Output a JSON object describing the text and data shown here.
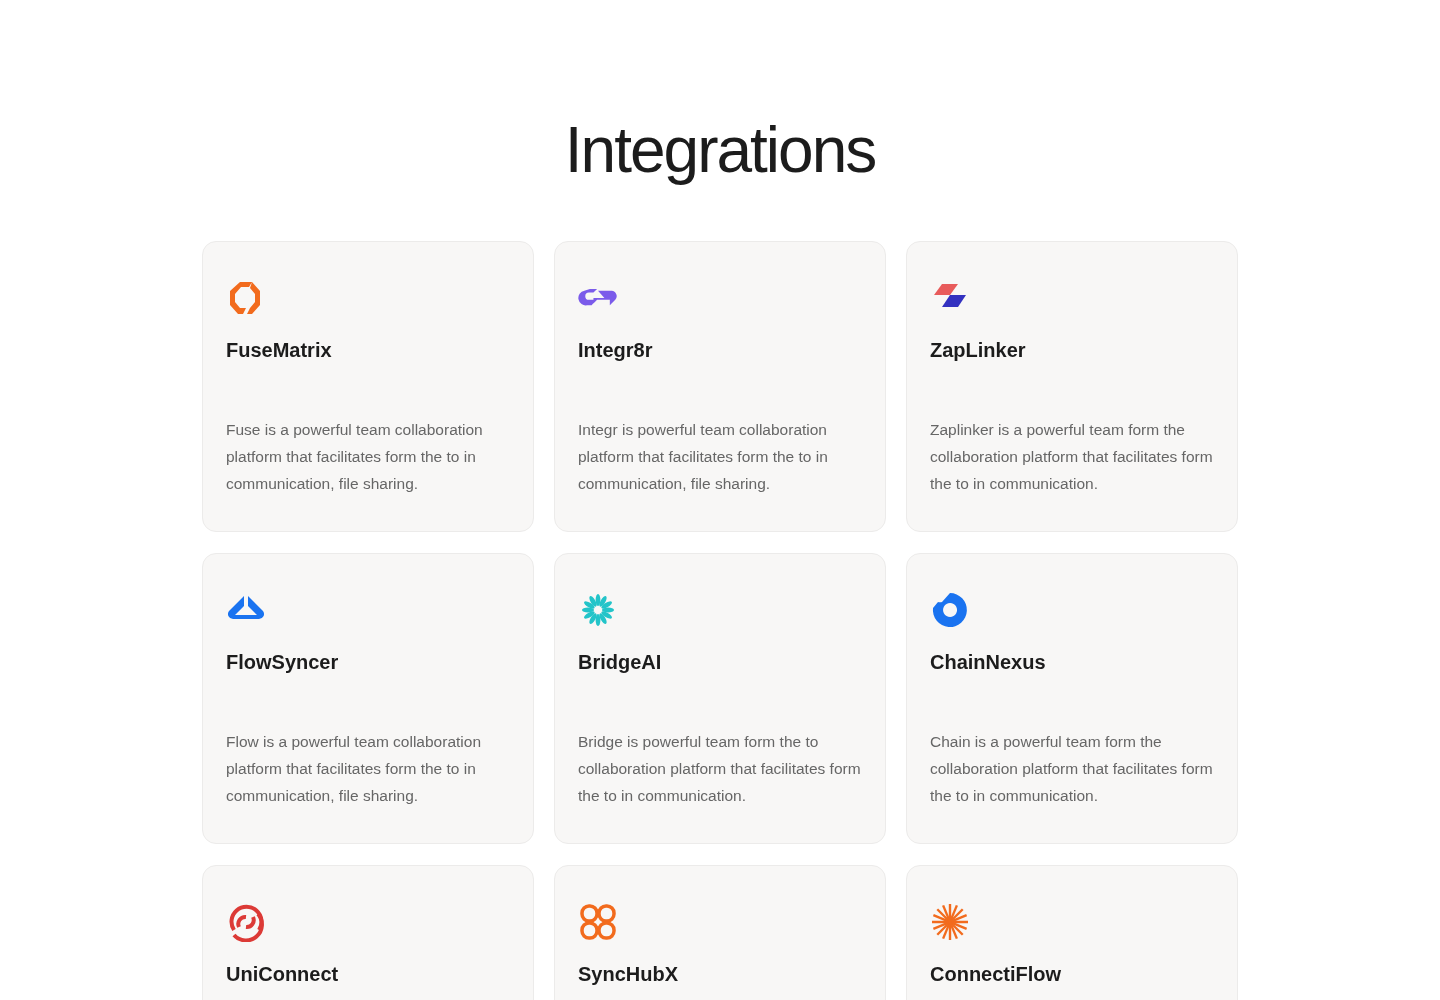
{
  "title": "Integrations",
  "cards": [
    {
      "name": "FuseMatrix",
      "description": "Fuse is a powerful team collaboration platform that facilitates form the to in communication, file sharing."
    },
    {
      "name": "Integr8r",
      "description": "Integr is powerful team collaboration platform that facilitates form the to in communication, file sharing."
    },
    {
      "name": "ZapLinker",
      "description": "Zaplinker is a powerful team form the collaboration platform that facilitates form the to in communication."
    },
    {
      "name": "FlowSyncer",
      "description": "Flow is a powerful team collaboration platform that facilitates form the to in communication, file sharing."
    },
    {
      "name": "BridgeAI",
      "description": "Bridge is powerful team form the to collaboration platform that facilitates form the to in communication."
    },
    {
      "name": "ChainNexus",
      "description": "Chain is a powerful team form the collaboration platform that facilitates form the to in communication."
    },
    {
      "name": "UniConnect"
    },
    {
      "name": "SyncHubX"
    },
    {
      "name": "ConnectiFlow"
    }
  ]
}
